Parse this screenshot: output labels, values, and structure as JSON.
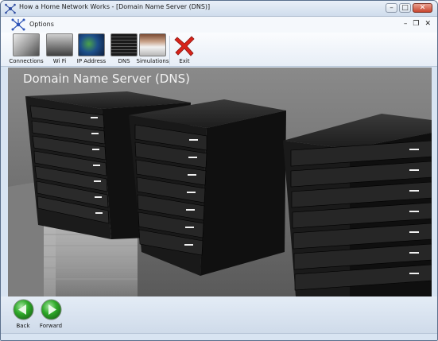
{
  "window": {
    "title": "How a Home Network Works - [Domain Name Server (DNS)]",
    "controls": {
      "minimize": "–",
      "maximize": "□",
      "close": "✕"
    }
  },
  "menubar": {
    "options_label": "Options",
    "mdi": {
      "minimize": "–",
      "restore": "❐",
      "close": "✕"
    }
  },
  "toolbar": {
    "items": [
      {
        "label": "Connections",
        "icon": "connections-thumbnail"
      },
      {
        "label": "Wi Fi",
        "icon": "wifi-thumbnail"
      },
      {
        "label": "IP Address",
        "icon": "ip-address-thumbnail"
      },
      {
        "label": "DNS",
        "icon": "dns-thumbnail"
      },
      {
        "label": "Simulations",
        "icon": "simulations-thumbnail"
      },
      {
        "label": "Exit",
        "icon": "red-x-icon"
      }
    ]
  },
  "main": {
    "title": "Domain Name Server (DNS)"
  },
  "nav": {
    "back_label": "Back",
    "forward_label": "Forward"
  },
  "colors": {
    "nav_green": "#2faa2a",
    "exit_red": "#d8231a",
    "scene_bg": "#6b6b6b",
    "chrome_bg": "#d8e4f2"
  }
}
